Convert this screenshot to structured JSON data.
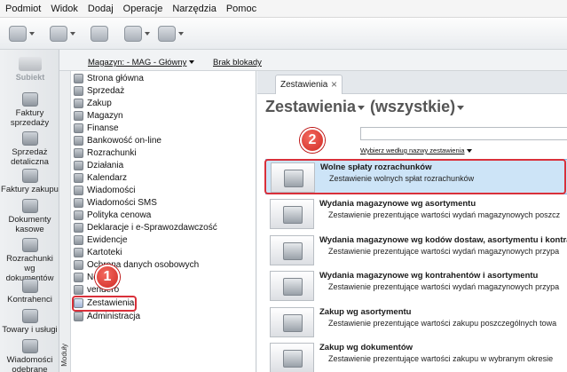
{
  "menu": [
    "Podmiot",
    "Widok",
    "Dodaj",
    "Operacje",
    "Narzędzia",
    "Pomoc"
  ],
  "toolbar_icons": [
    "new-document-icon",
    "open-folder-icon",
    "cashbox-icon",
    "package-icon",
    "help-icon"
  ],
  "logo_text": "Subiekt",
  "left_nav": [
    {
      "label": "Faktury sprzedaży",
      "icon": "sales-invoice-icon"
    },
    {
      "label": "Sprzedaż detaliczna",
      "icon": "retail-icon"
    },
    {
      "label": "Faktury zakupu",
      "icon": "purchase-invoice-icon"
    },
    {
      "label": "Dokumenty kasowe",
      "icon": "cash-documents-icon"
    },
    {
      "label": "Rozrachunki wg dokumentów",
      "icon": "settlements-icon"
    },
    {
      "label": "Kontrahenci",
      "icon": "contractors-icon"
    },
    {
      "label": "Towary i usługi",
      "icon": "goods-icon"
    },
    {
      "label": "Wiadomości odebrane",
      "icon": "messages-icon"
    }
  ],
  "top_strip": {
    "warehouse": "Magazyn: - MAG - Główny",
    "lock": "Brak blokady"
  },
  "tree_side_tab": "Moduły",
  "tree": [
    "Strona główna",
    "Sprzedaż",
    "Zakup",
    "Magazyn",
    "Finanse",
    "Bankowość on-line",
    "Rozrachunki",
    "Działania",
    "Kalendarz",
    "Wiadomości",
    "Wiadomości SMS",
    "Polityka cenowa",
    "Deklaracje i e-Sprawozdawczość",
    "Ewidencje",
    "Kartoteki",
    "Ochrona danych osobowych",
    "Nexo",
    "vendero",
    "Zestawienia",
    "Administracja"
  ],
  "markers": [
    "1",
    "2"
  ],
  "tab": {
    "label": "Zestawienia",
    "close": "×"
  },
  "heading": {
    "title": "Zestawienia",
    "filter": "(wszystkie)"
  },
  "sort_link": "Wybierz według nazwy zestawienia",
  "reports": [
    {
      "title": "Wolne spłaty rozrachunków",
      "desc": "Zestawienie wolnych spłat rozrachunków"
    },
    {
      "title": "Wydania magazynowe wg asortymentu",
      "desc": "Zestawienie prezentujące wartości wydań magazynowych poszcz"
    },
    {
      "title": "Wydania magazynowe wg kodów dostaw, asortymentu i kontrahe",
      "desc": "Zestawienie prezentujące wartości wydań magazynowych przypa"
    },
    {
      "title": "Wydania magazynowe wg kontrahentów i asortymentu",
      "desc": "Zestawienie prezentujące wartości wydań magazynowych przypa"
    },
    {
      "title": "Zakup wg asortymentu",
      "desc": "Zestawienie prezentujące wartości zakupu poszczególnych towa"
    },
    {
      "title": "Zakup wg dokumentów",
      "desc": "Zestawienie prezentujące wartości zakupu w wybranym okresie"
    }
  ]
}
